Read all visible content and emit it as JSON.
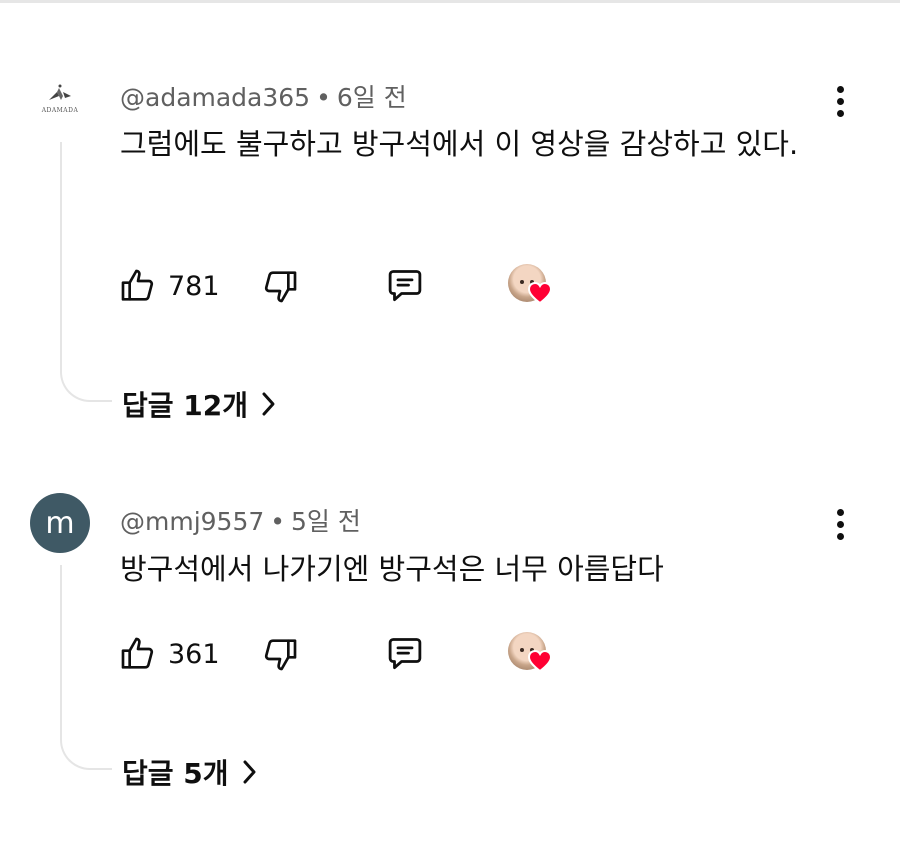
{
  "comments": [
    {
      "author": "@adamada365",
      "separator": "•",
      "time": "6일 전",
      "avatar": {
        "type": "logo",
        "logo_text": "ADAMADA",
        "icon": "adamada-logo-icon"
      },
      "text": "그럼에도 불구하고 방구석에서 이 영상을 감상하고 있다.",
      "likes": "781",
      "replies_label": "답글 12개",
      "creator_hearted": true
    },
    {
      "author": "@mmj9557",
      "separator": "•",
      "time": "5일 전",
      "avatar": {
        "type": "letter",
        "letter": "m",
        "color": "#3f5965"
      },
      "text": "방구석에서 나가기엔 방구석은 너무 아름답다",
      "likes": "361",
      "replies_label": "답글 5개",
      "creator_hearted": true
    }
  ],
  "icons": {
    "like": "thumbs-up-icon",
    "dislike": "thumbs-down-icon",
    "reply": "comment-reply-icon",
    "more": "more-vertical-icon",
    "heart": "heart-icon",
    "chevron": "chevron-right-icon"
  },
  "colors": {
    "heart": "#ff0033",
    "meta_text": "#606060",
    "thread_line": "#e5e5e5"
  }
}
